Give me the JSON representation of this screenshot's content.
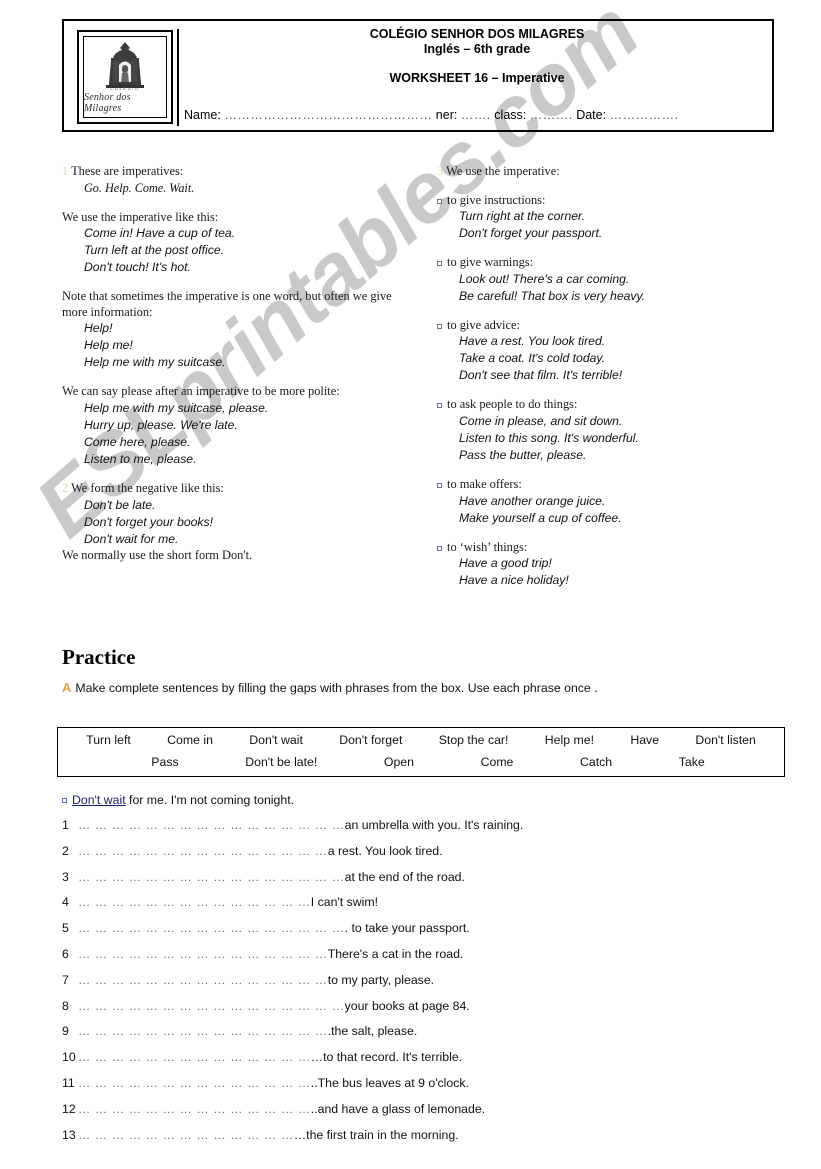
{
  "watermark": {
    "text": "ESLprintables.com"
  },
  "header": {
    "logo": {
      "icon": "shrine-logo-icon",
      "colegio_label": "COLÉGIO",
      "script_label": "Senhor dos Milagres"
    },
    "school_name": "COLÉGIO SENHOR DOS MILAGRES",
    "subject_grade": "Inglés – 6th grade",
    "worksheet_title": "WORKSHEET 16 – Imperative",
    "name_label": "Name:",
    "name_dots": "…………………………………………",
    "ner_label": "ner:",
    "ner_dots": "…….",
    "class_label": "class:",
    "class_dots": "……….",
    "date_label": "Date:",
    "date_dots": "……………."
  },
  "theory": {
    "left": [
      {
        "number": "1",
        "lead": "These are imperatives:",
        "examples": [
          "Go. Help. Come. Wait."
        ],
        "style": "serif"
      },
      {
        "number": "",
        "lead": "We use the imperative like this:",
        "examples": [
          "Come in! Have a cup of tea.",
          "Turn left at the post office.",
          "Don't touch! It's hot."
        ],
        "style": "sans"
      },
      {
        "number": "",
        "lead": "Note that sometimes the imperative is one word, but often we give more information:",
        "examples": [
          "Help!",
          "Help me!",
          "Help me with my suitcase."
        ],
        "style": "sans"
      },
      {
        "number": "",
        "lead": "We can say please after an imperative to be more polite:",
        "examples": [
          "Help me with my suitcase, please.",
          "Hurry up, please. We're late.",
          "Come here, please.",
          "Listen to me, please."
        ],
        "style": "sans"
      },
      {
        "number": "2",
        "lead": "We form the negative like this:",
        "examples": [
          "Don't be late.",
          "Don't forget your books!",
          "Don't wait for me."
        ],
        "style": "sans",
        "footer": "We normally use the short form Don't."
      }
    ],
    "right_heading_number": "3",
    "right_heading": "We use the imperative:",
    "right": [
      {
        "label": "to give instructions:",
        "examples": [
          "Turn right at the corner.",
          "Don't forget your passport."
        ]
      },
      {
        "label": "to give warnings:",
        "examples": [
          "Look out! There's a car coming.",
          "Be careful! That box is very heavy."
        ]
      },
      {
        "label": "to give advice:",
        "examples": [
          "Have a rest. You look tired.",
          "Take a coat. It's cold today.",
          "Don't see that film. It's terrible!"
        ]
      },
      {
        "label": "to ask people to do things:",
        "examples": [
          "Come in please, and sit down.",
          "Listen to this song. It's wonderful.",
          "Pass the butter, please."
        ]
      },
      {
        "label": "to make offers:",
        "examples": [
          "Have another orange juice.",
          "Make yourself a cup of coffee."
        ]
      },
      {
        "label": "to ‘wish’ things:",
        "examples": [
          "Have a good trip!",
          "Have a nice holiday!"
        ]
      }
    ]
  },
  "practice": {
    "title": "Practice",
    "task_letter": "A",
    "task_text": "Make complete sentences by filling the gaps with phrases from the box. Use each phrase once .",
    "phrase_box": {
      "row1": [
        "Turn left",
        "Come in",
        "Don't wait",
        "Don't forget",
        "Stop the car!",
        "Help me!",
        "Have",
        "Don't listen"
      ],
      "row2": [
        "Pass",
        "Don't be late!",
        "Open",
        "Come",
        "Catch",
        "Take"
      ]
    },
    "example": {
      "answer": "Don't wait",
      "rest": " for me. I'm not coming tonight."
    },
    "questions": [
      {
        "number": "1",
        "gap": "… … … … … … … … … … … … … … … …",
        "tail": "an umbrella with you. It's raining."
      },
      {
        "number": "2",
        "gap": "… … … … … … … … … … … … … … …",
        "tail": "a rest. You look tired."
      },
      {
        "number": "3",
        "gap": "… … … … … … … … … … … … … … … …",
        "tail": "at the end of the road."
      },
      {
        "number": "4",
        "gap": "… … … … … … … … … … … … … …",
        "tail": "I can't swim!"
      },
      {
        "number": "5",
        "gap": "… … … … … … … … … … … … … … … …",
        "tail": ". to take your passport."
      },
      {
        "number": "6",
        "gap": "… … … … … … … … … … … … … … …",
        "tail": "There's a cat in the road."
      },
      {
        "number": "7",
        "gap": "… … … … … … … … … … … … … … …",
        "tail": " to my party, please."
      },
      {
        "number": "8",
        "gap": "… … … … … … … … … … … … … … … …",
        "tail": "your books at page 84."
      },
      {
        "number": "9",
        "gap": "… … … … … … … … … … … … … … …",
        "tail": ".the salt, please."
      },
      {
        "number": "10",
        "gap": "… … … … … … … … … … … … … …",
        "tail": "…to that record. It's terrible."
      },
      {
        "number": "11",
        "gap": "… … … … … … … … … … … … … …",
        "tail": "..The bus leaves at 9 o'clock."
      },
      {
        "number": "12",
        "gap": "… … … … … … … … … … … … … …",
        "tail": "..and have a glass of lemonade."
      },
      {
        "number": "13",
        "gap": "… … … … … … … … … … … … …",
        "tail": "…the first train in the morning."
      }
    ]
  }
}
